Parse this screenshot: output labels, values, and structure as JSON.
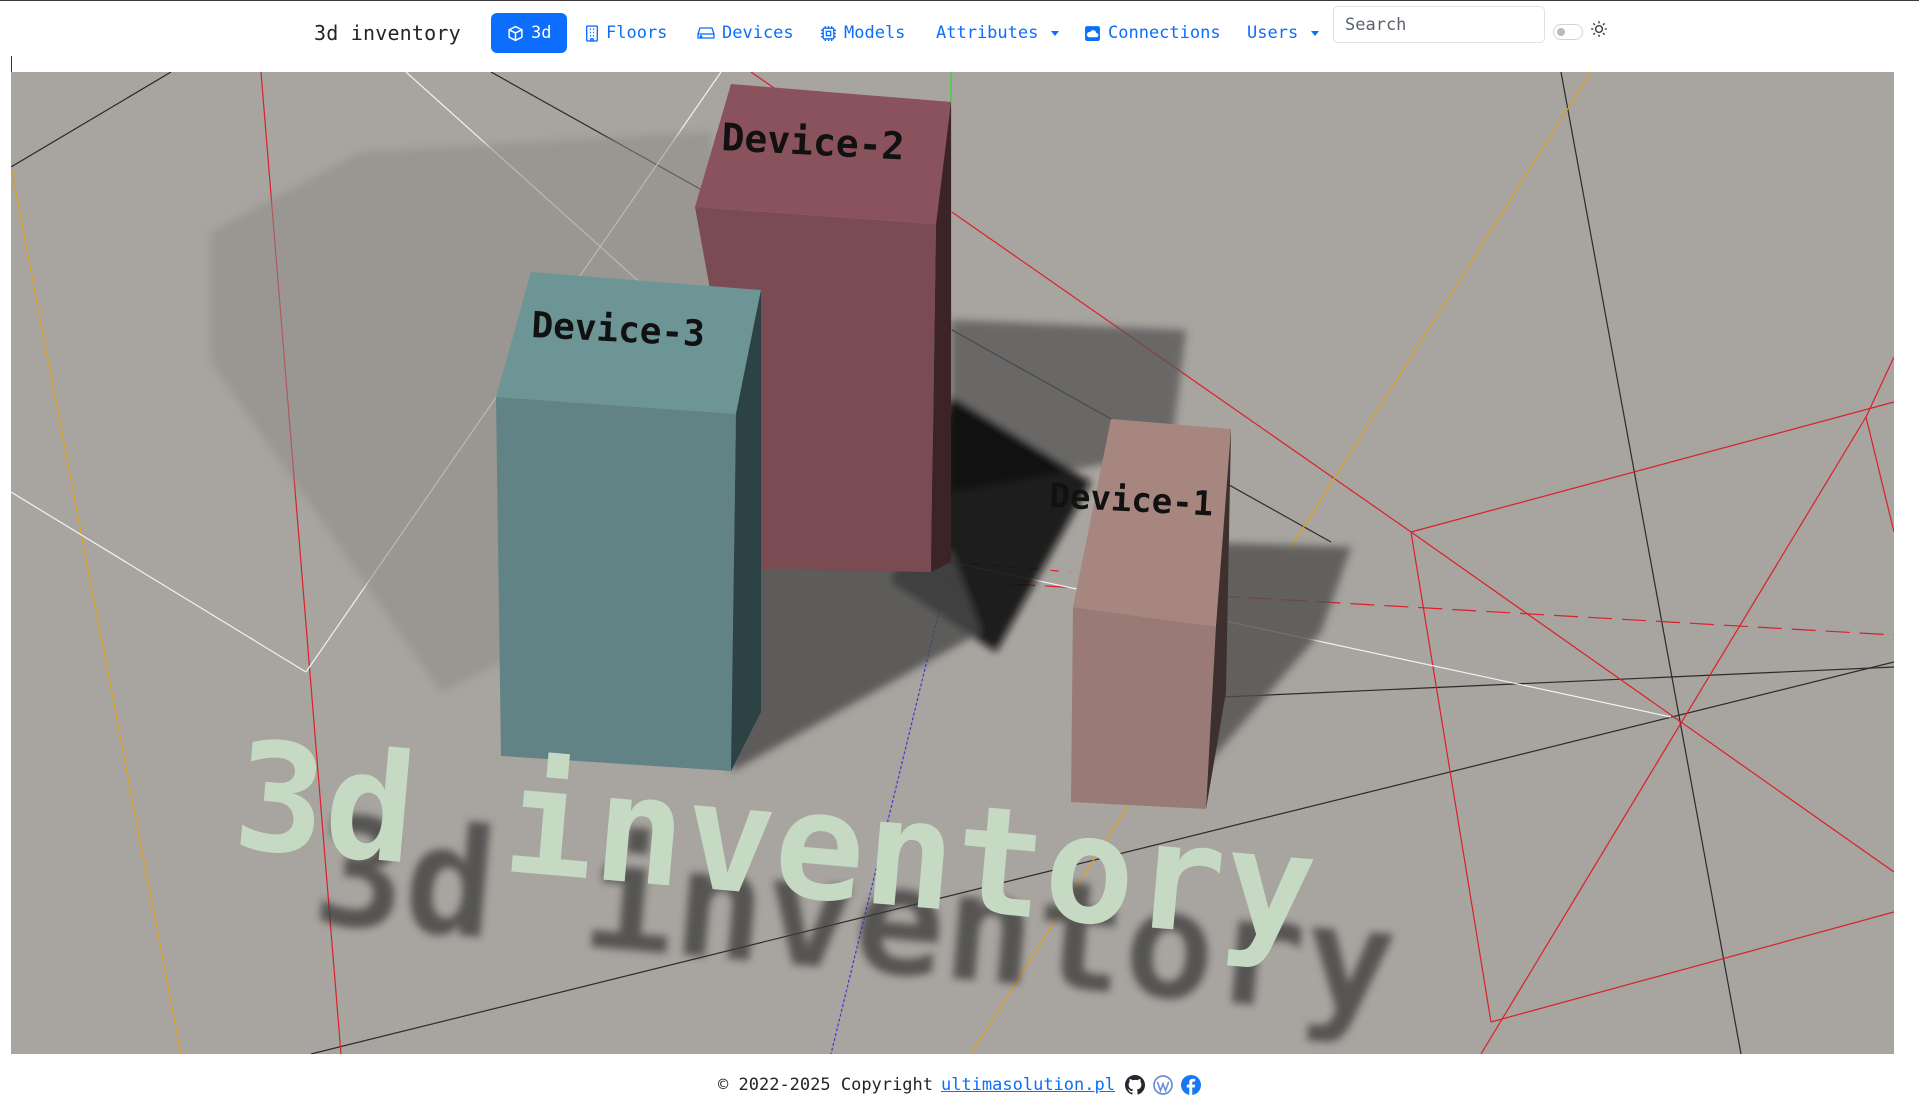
{
  "app": {
    "title": "3d inventory"
  },
  "nav": {
    "items": [
      {
        "label": "3d",
        "icon": "cube-icon",
        "active": true
      },
      {
        "label": "Floors",
        "icon": "building-icon"
      },
      {
        "label": "Devices",
        "icon": "hdd-icon"
      },
      {
        "label": "Models",
        "icon": "cpu-icon"
      },
      {
        "label": "Attributes",
        "dropdown": true
      },
      {
        "label": "Connections",
        "icon": "cloud-icon"
      },
      {
        "label": "Users",
        "dropdown": true
      }
    ],
    "search_placeholder": "Search",
    "theme_toggle": {
      "state": "off",
      "icon": "sun-icon"
    }
  },
  "scene": {
    "background_color": "#a8a49f",
    "title_text": "3d inventory",
    "title_color": "#c6d9c3",
    "devices": [
      {
        "name": "Device-1",
        "color": "#9a7a76"
      },
      {
        "name": "Device-2",
        "color": "#7a4b53"
      },
      {
        "name": "Device-3",
        "color": "#628385"
      }
    ]
  },
  "footer": {
    "copyright": "© 2022-2025 Copyright",
    "link_text": "ultimasolution.pl",
    "icons": [
      "github-icon",
      "wordpress-icon",
      "facebook-icon"
    ]
  }
}
